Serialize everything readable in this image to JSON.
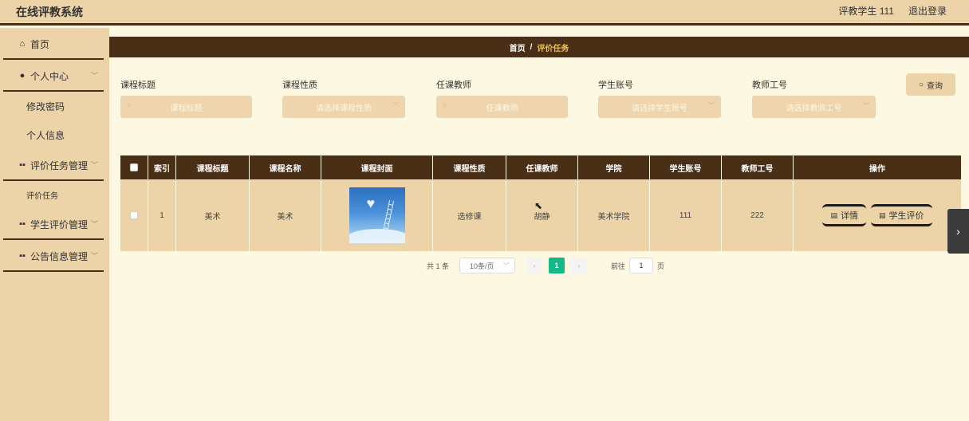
{
  "app": {
    "title": "在线评教系统",
    "user": "评教学生 111",
    "logout": "退出登录"
  },
  "sidebar": {
    "home": "首页",
    "personal": "个人中心",
    "change_password": "修改密码",
    "personal_info": "个人信息",
    "eval_task_mgmt": "评价任务管理",
    "eval_task": "评价任务",
    "student_eval_mgmt": "学生评价管理",
    "notice_mgmt": "公告信息管理"
  },
  "breadcrumb": {
    "home": "首页",
    "sep": "/",
    "current": "评价任务"
  },
  "search": {
    "course_title": {
      "label": "课程标题",
      "placeholder": "课程标题"
    },
    "course_type": {
      "label": "课程性质",
      "placeholder": "请选择课程性质"
    },
    "teacher": {
      "label": "任课教师",
      "placeholder": "任课教师"
    },
    "student_no": {
      "label": "学生账号",
      "placeholder": "请选择学生账号"
    },
    "teacher_no": {
      "label": "教师工号",
      "placeholder": "请选择教师工号"
    },
    "query_button": "查询"
  },
  "table": {
    "headers": {
      "index": "索引",
      "title": "课程标题",
      "name": "课程名称",
      "cover": "课程封面",
      "type": "课程性质",
      "teacher": "任课教师",
      "college": "学院",
      "student_no": "学生账号",
      "teacher_no": "教师工号",
      "ops": "操作"
    },
    "rows": [
      {
        "index": "1",
        "title": "美术",
        "name": "美术",
        "type": "选修课",
        "teacher": "胡静",
        "college": "美术学院",
        "student_no": "111",
        "teacher_no": "222",
        "detail": "详情",
        "evaluate": "学生评价"
      }
    ]
  },
  "pagination": {
    "total": "共 1 条",
    "page_size": "10条/页",
    "current_page": "1",
    "goto_prefix": "前往",
    "goto_value": "1",
    "goto_suffix": "页"
  },
  "colors": {
    "header_bg": "#ecd3a8",
    "dark_brown": "#4a2f17",
    "page_bg": "#fdf8e1",
    "accent": "#f1c24a",
    "active_page": "#14b98a"
  }
}
